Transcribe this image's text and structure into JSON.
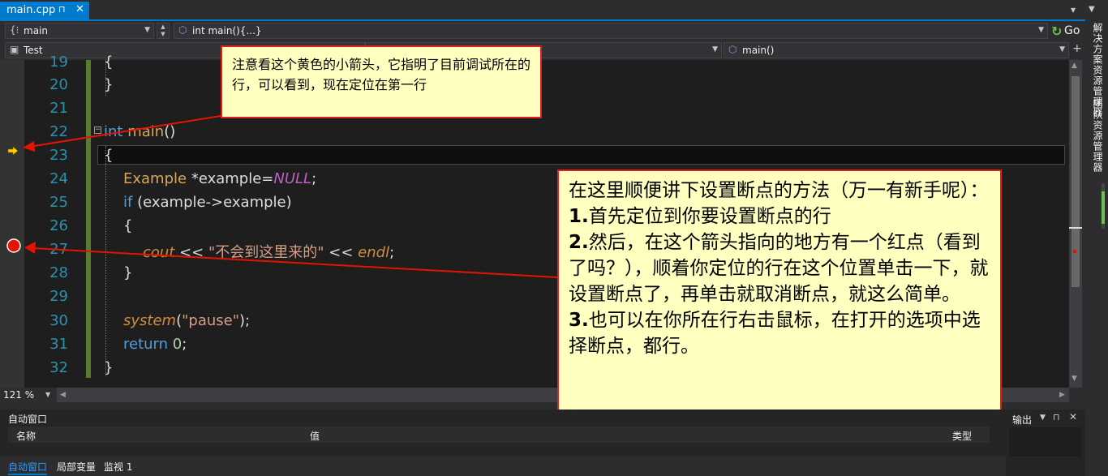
{
  "tab": {
    "filename": "main.cpp",
    "pin": "⊓",
    "close": "✕"
  },
  "nav": {
    "scope": "main",
    "function": "int main(){...}",
    "go": "Go",
    "project": "Test",
    "member": "main()"
  },
  "right_panel": {
    "tabs": [
      "解决方案资源管理器",
      "团队资源管理器"
    ]
  },
  "editor": {
    "lines": [
      "19",
      "20",
      "21",
      "22",
      "23",
      "24",
      "25",
      "26",
      "27",
      "28",
      "29",
      "30",
      "31",
      "32"
    ],
    "code": {
      "l19": "{",
      "l20": "}",
      "l22_kw": "int",
      "l22_fn": "main",
      "l22_rest": "()",
      "l23": "{",
      "l24_type": "Example",
      "l24_mid": " *example=",
      "l24_null": "NULL",
      "l24_end": ";",
      "l25_kw": "if",
      "l25_rest": " (example->example)",
      "l26": "{",
      "l27_cout": "cout",
      "l27_op1": " << ",
      "l27_str": "\"不会到这里来的\"",
      "l27_op2": " << ",
      "l27_endl": "endl",
      "l27_end": ";",
      "l28": "}",
      "l30_fn": "system",
      "l30_open": "(",
      "l30_str": "\"pause\"",
      "l30_end": ");",
      "l31_kw": "return",
      "l31_num": "0",
      "l31_end": ";",
      "l32": "}"
    },
    "zoom": "121 %"
  },
  "callouts": {
    "c1": "注意看这个黄色的小箭头，它指明了目前调试所在的行，可以看到，现在定位在第一行",
    "c2_l1": "在这里顺便讲下设置断点的方法（万一有新手呢）：",
    "c2_n1": "1.",
    "c2_l2": "首先定位到你要设置断点的行",
    "c2_n2": "2.",
    "c2_l3": "然后，在这个箭头指向的地方有一个红点（看到了吗？），顺着你定位的行在这个位置单击一下，就设置断点了，再单击就取消断点，就这么简单。",
    "c2_n3": "3.",
    "c2_l4": "也可以在你所在行右击鼠标，在打开的选项中选择断点，都行。"
  },
  "autos": {
    "title": "自动窗口",
    "col_name": "名称",
    "col_value": "值",
    "col_type": "类型"
  },
  "output": {
    "title": "输出"
  },
  "bottom_tabs": [
    "自动窗口",
    "局部变量",
    "监视 1"
  ],
  "colors": {
    "accent": "#007acc",
    "breakpoint": "#e51400",
    "arrow": "#ffcc00",
    "callout_bg": "#ffffc0",
    "callout_border": "#e02020"
  }
}
